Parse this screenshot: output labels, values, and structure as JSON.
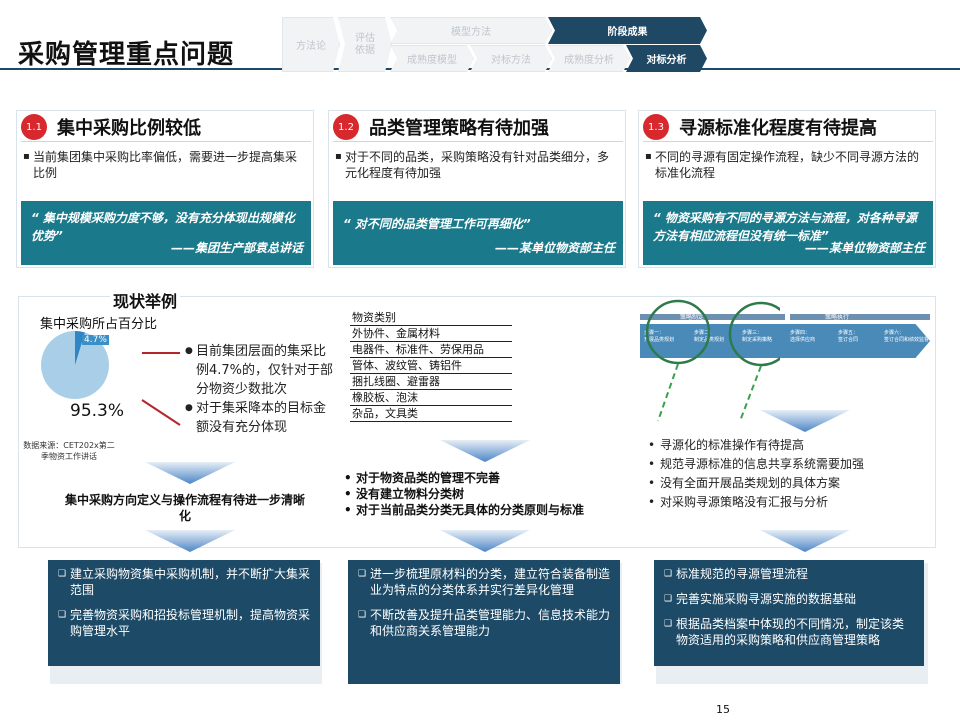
{
  "page": {
    "title": "采购管理重点问题",
    "page_number": "15"
  },
  "nav": {
    "steps": [
      "方法论",
      "评估\n依据",
      "模型方法",
      "阶段成果",
      "成熟度模型",
      "对标方法",
      "成熟度分析",
      "对标分析"
    ],
    "active": [
      "阶段成果",
      "对标分析"
    ]
  },
  "issues": [
    {
      "num": "1.1",
      "heading": "集中采购比例较低",
      "text": "当前集团集中采购比率偏低，需要进一步提高集采比例",
      "quote": "“ 集中规模采购力度不够，没有充分体现出规模化优势”",
      "quote_source": "——集团生产部袁总讲话"
    },
    {
      "num": "1.2",
      "heading": "品类管理策略有待加强",
      "text": "对于不同的品类，采购策略没有针对品类细分，多元化程度有待加强",
      "quote": "“ 对不同的品类管理工作可再细化”",
      "quote_source": "——某单位物资部主任"
    },
    {
      "num": "1.3",
      "heading": "寻源标准化程度有待提高",
      "text": "不同的寻源有固定操作流程，缺少不同寻源方法的标准化流程",
      "quote": "“ 物资采购有不同的寻源方法与流程，对各种寻源方法有相应流程但没有统一标准”",
      "quote_source": "——某单位物资部主任"
    }
  ],
  "examples": {
    "section_title": "现状举例",
    "pie": {
      "label": "集中采购所占百分比",
      "big_value": "95.3%",
      "small_value": "4.7%",
      "source": "数据来源：CET202x第二季物资工作讲话",
      "colors": {
        "big": "#a9cfe8",
        "small": "#2f86c4"
      }
    },
    "pie_bullets": [
      "目前集团层面的集采比例4.7%的，仅针对于部分物资少数批次",
      "对于集采降本的目标金额没有充分体现"
    ],
    "category_list": [
      "物资类别",
      "外协件、金属材料",
      "电器件、标准件、劳保用品",
      "管体、波纹管、铸铝件",
      "捆扎线圈、避雷器",
      "橡胶板、泡沫",
      "杂品，文具类"
    ],
    "process": {
      "phases": [
        "策略制定",
        "策略执行"
      ],
      "steps": [
        "步骤一：\n开展品类规划",
        "步骤二：\n制定品类规划",
        "步骤三：\n制定采购策略",
        "步骤四：\n选择供应商",
        "步骤五：\n签订合同",
        "步骤六：\n签订合同和绩效监督"
      ]
    },
    "process_bullets": [
      "寻源化的标准操作有待提高",
      "规范寻源标准的信息共享系统需要加强",
      "没有全面开展品类规划的具体方案",
      "对采购寻源策略没有汇报与分析"
    ],
    "left_caption": "集中采购方向定义与操作流程有待进一步清晰化",
    "center_bullets": [
      "对于物资品类的管理不完善",
      "没有建立物料分类树",
      "对于当前品类分类无具体的分类原则与标准"
    ]
  },
  "recommendations": [
    [
      "建立采购物资集中采购机制，并不断扩大集采范围",
      "完善物资采购和招投标管理机制，提高物资采购管理水平"
    ],
    [
      " 进一步梳理原材料的分类，建立符合装备制造业为特点的分类体系并实行差异化管理",
      "不断改善及提升品类管理能力、信息技术能力和供应商关系管理能力"
    ],
    [
      "标准规范的寻源管理流程",
      "完善实施采购寻源实施的数据基础",
      "根据品类档案中体现的不同情况，制定该类物资适用的采购策略和供应商管理策略"
    ]
  ],
  "colors": {
    "accent_dark": "#1d4a66",
    "quote_teal": "#1a7a8b",
    "badge_red": "#d7282e"
  }
}
